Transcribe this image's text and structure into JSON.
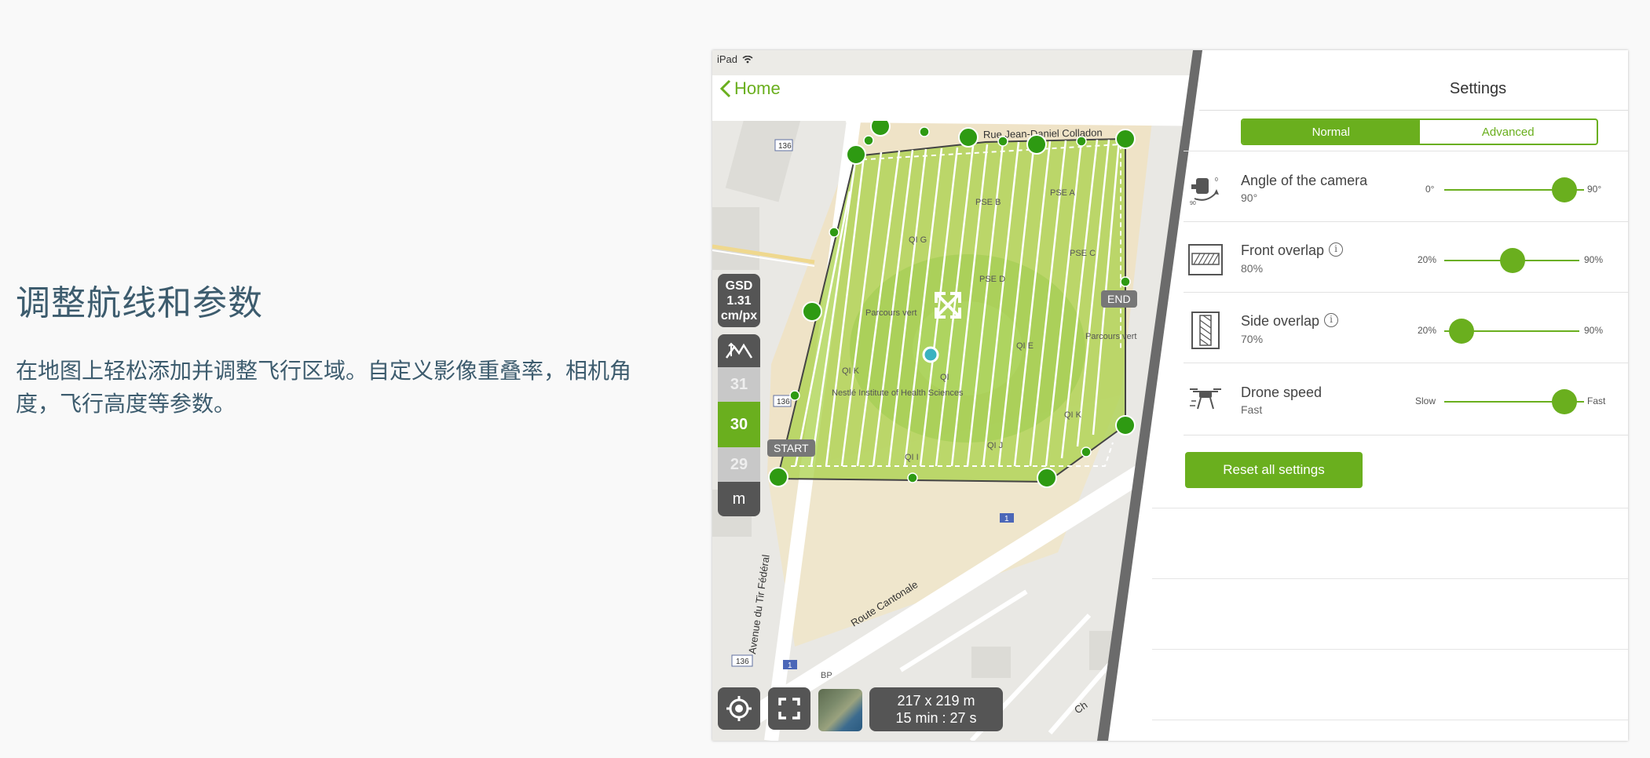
{
  "intro": {
    "title": "调整航线和参数",
    "description": "在地图上轻松添加并调整飞行区域。自定义影像重叠率，相机角度，飞行高度等参数。"
  },
  "status_bar": {
    "device": "iPad"
  },
  "nav": {
    "back_label": "Home"
  },
  "map": {
    "street_labels": [
      "Rue Jean-Daniel Colladon",
      "Avenue du Tir Fédéral",
      "Route Cantonale",
      "Ch"
    ],
    "place_labels": [
      "PSE B",
      "PSE A",
      "QI G",
      "PSE C",
      "PSE D",
      "Parcours vert",
      "Parcours vert",
      "QI E",
      "QI K",
      "QI",
      "Nestlé Institute of Health Sciences",
      "QI K",
      "QI J",
      "QI I",
      "BP"
    ],
    "route_badges": [
      "136",
      "136",
      "136",
      "1",
      "1"
    ],
    "start_label": "START",
    "end_label": "END",
    "gsd": {
      "label": "GSD",
      "value": "1.31",
      "unit": "cm/px"
    },
    "altitude": {
      "above": "31",
      "selected": "30",
      "below": "29",
      "unit": "m"
    },
    "dimensions": "217 x 219 m",
    "duration": "15 min : 27 s"
  },
  "settings": {
    "title": "Settings",
    "tabs": [
      {
        "label": "Normal",
        "active": true
      },
      {
        "label": "Advanced",
        "active": false
      }
    ],
    "rows": [
      {
        "label": "Angle of the camera",
        "value": "90°",
        "min": "0°",
        "max": "90°",
        "position": 0.9,
        "info": false,
        "icon": "camera-angle-icon"
      },
      {
        "label": "Front overlap",
        "value": "80%",
        "min": "20%",
        "max": "90%",
        "position": 0.55,
        "info": true,
        "icon": "front-overlap-icon"
      },
      {
        "label": "Side overlap",
        "value": "70%",
        "min": "20%",
        "max": "90%",
        "position": 0.08,
        "info": true,
        "icon": "side-overlap-icon"
      },
      {
        "label": "Drone speed",
        "value": "Fast",
        "min": "Slow",
        "max": "Fast",
        "position": 0.9,
        "info": false,
        "icon": "drone-icon"
      }
    ],
    "reset_label": "Reset all settings"
  },
  "colors": {
    "accent": "#6aaf1e",
    "text_heading": "#3d5c6e",
    "panel_dark": "#555555"
  }
}
